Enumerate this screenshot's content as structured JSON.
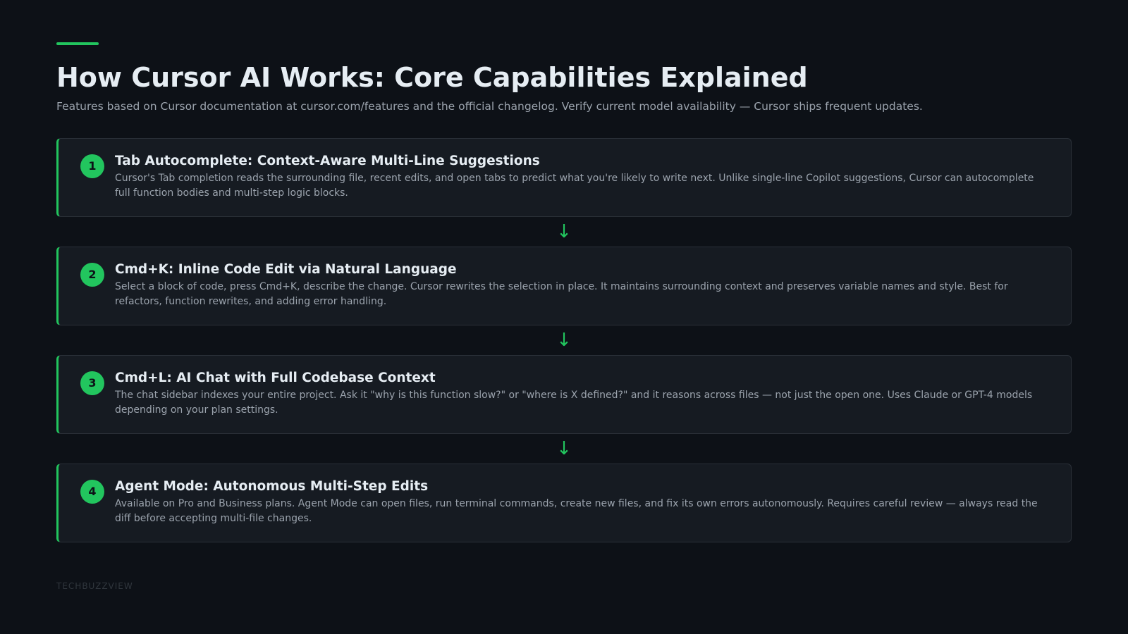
{
  "header": {
    "title": "How Cursor AI Works: Core Capabilities Explained",
    "subtitle": "Features based on Cursor documentation at cursor.com/features and the official changelog. Verify current model availability — Cursor ships frequent updates."
  },
  "steps": [
    {
      "number": "1",
      "title": "Tab Autocomplete: Context-Aware Multi-Line Suggestions",
      "description": "Cursor's Tab completion reads the surrounding file, recent edits, and open tabs to predict what you're likely to write next. Unlike single-line Copilot suggestions, Cursor can autocomplete full function bodies and multi-step logic blocks."
    },
    {
      "number": "2",
      "title": "Cmd+K: Inline Code Edit via Natural Language",
      "description": "Select a block of code, press Cmd+K, describe the change. Cursor rewrites the selection in place. It maintains surrounding context and preserves variable names and style. Best for refactors, function rewrites, and adding error handling."
    },
    {
      "number": "3",
      "title": "Cmd+L: AI Chat with Full Codebase Context",
      "description": "The chat sidebar indexes your entire project. Ask it \"why is this function slow?\" or \"where is X defined?\" and it reasons across files — not just the open one. Uses Claude or GPT-4 models depending on your plan settings."
    },
    {
      "number": "4",
      "title": "Agent Mode: Autonomous Multi-Step Edits",
      "description": "Available on Pro and Business plans. Agent Mode can open files, run terminal commands, create new files, and fix its own errors autonomously. Requires careful review — always read the diff before accepting multi-file changes."
    }
  ],
  "connector_symbol": "↓",
  "footer": {
    "brand": "TECHBUZZVIEW"
  },
  "colors": {
    "background": "#0d1117",
    "accent": "#22c55e",
    "card": "#161b22"
  }
}
